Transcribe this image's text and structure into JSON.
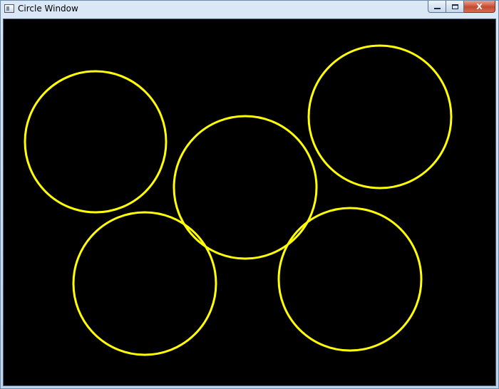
{
  "window": {
    "title": "Circle Window",
    "controls": {
      "minimize": "minimize",
      "maximize": "maximize",
      "close": "X"
    }
  },
  "canvas": {
    "background": "#000000",
    "stroke_color": "#ffff00",
    "circle_count": 5
  }
}
